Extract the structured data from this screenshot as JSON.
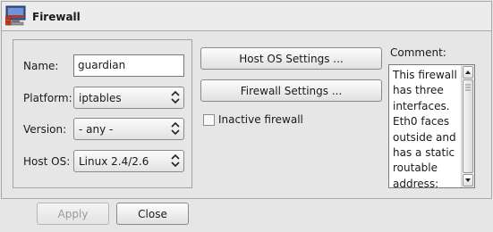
{
  "header": {
    "title": "Firewall",
    "icon": "firewall-icon"
  },
  "form": {
    "name_label": "Name:",
    "name_value": "guardian",
    "platform_label": "Platform:",
    "platform_value": "iptables",
    "version_label": "Version:",
    "version_value": "- any -",
    "hostos_label": "Host OS:",
    "hostos_value": "Linux 2.4/2.6"
  },
  "actions": {
    "host_os_settings": "Host OS Settings ...",
    "firewall_settings": "Firewall Settings ...",
    "inactive_label": "Inactive firewall",
    "inactive_checked": false
  },
  "comment": {
    "label": "Comment:",
    "text": "This firewall\nhas three\ninterfaces.\nEth0 faces\noutside and\nhas a static\nroutable\naddress;"
  },
  "footer": {
    "apply_label": "Apply",
    "close_label": "Close"
  },
  "colors": {
    "background": "#e6e6e6",
    "field": "#ffffff"
  }
}
